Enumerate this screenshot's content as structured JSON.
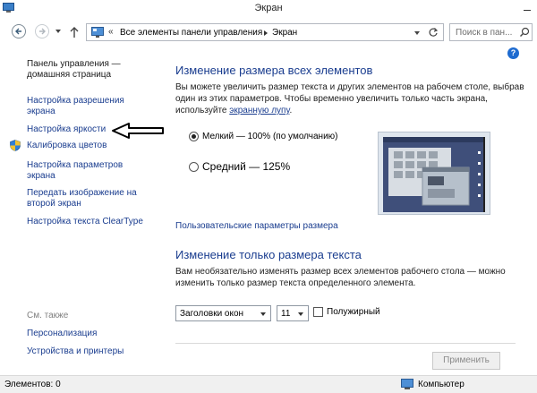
{
  "window": {
    "title": "Экран"
  },
  "address": {
    "crumb1": "Все элементы панели управления",
    "crumb2": "Экран",
    "search_placeholder": "Поиск в пан..."
  },
  "leftnav": {
    "home": "Панель управления — домашняя страница",
    "resolution": "Настройка разрешения экрана",
    "brightness": "Настройка яркости",
    "calibration": "Калибровка цветов",
    "params": "Настройка параметров экрана",
    "project": "Передать изображение на второй экран",
    "cleartype": "Настройка текста ClearType",
    "see_also": "См. также",
    "personalization": "Персонализация",
    "devices": "Устройства и принтеры"
  },
  "main": {
    "heading1": "Изменение размера всех элементов",
    "desc1_a": "Вы можете увеличить размер текста и других элементов на рабочем столе, выбрав один из этих параметров. Чтобы временно увеличить только часть экрана, используйте ",
    "desc1_link": "экранную лупу",
    "desc1_b": ".",
    "option1": "Мелкий — 100% (по умолчанию)",
    "option2": "Средний — 125%",
    "custom_link": "Пользовательские параметры размера",
    "heading2": "Изменение только размера текста",
    "desc2": "Вам необязательно изменять размер всех элементов рабочего стола — можно изменить только размер текста определенного элемента.",
    "element_select": "Заголовки окон",
    "size_select": "11",
    "bold_label": "Полужирный",
    "apply": "Применить"
  },
  "status": {
    "items": "Элементов: 0",
    "location": "Компьютер"
  },
  "colors": {
    "link": "#1a3d8f",
    "preview_bg": "#3f4f7a"
  }
}
